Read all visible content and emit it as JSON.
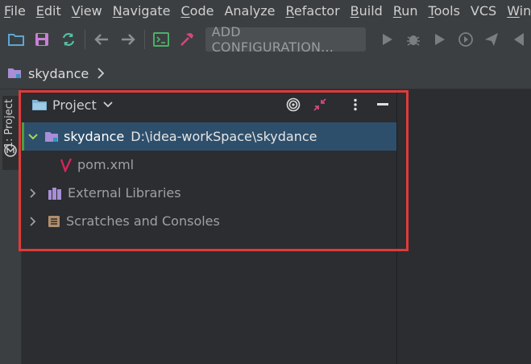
{
  "menu": {
    "items": [
      {
        "underline": "F",
        "rest": "ile"
      },
      {
        "underline": "E",
        "rest": "dit"
      },
      {
        "underline": "V",
        "rest": "iew"
      },
      {
        "underline": "N",
        "rest": "avigate"
      },
      {
        "underline": "C",
        "rest": "ode"
      },
      {
        "underline": "",
        "rest": "Analyze"
      },
      {
        "underline": "R",
        "rest": "efactor"
      },
      {
        "underline": "B",
        "rest": "uild"
      },
      {
        "underline": "R",
        "rest": "un",
        "prefix": ""
      },
      {
        "underline": "T",
        "rest": "ools"
      },
      {
        "underline": "",
        "rest": "VCS"
      },
      {
        "underline": "W",
        "rest": "indo"
      }
    ]
  },
  "toolbar": {
    "config_label": "ADD CONFIGURATION...",
    "icons": [
      "folder-open-icon",
      "save-icon",
      "sync-icon",
      "back-icon",
      "forward-icon",
      "terminal-icon",
      "build-hammer-icon",
      "run-icon",
      "debug-icon",
      "run-coverage-icon",
      "profile-icon",
      "deploy-icon"
    ]
  },
  "breadcrumb": {
    "project": "skydance"
  },
  "side_strip": {
    "tab_label": "1: Project"
  },
  "project_panel": {
    "title": "Project",
    "tree": [
      {
        "name": "skydance",
        "path": "D:\\idea-workSpace\\skydance",
        "expanded": true,
        "selected": true
      },
      {
        "name": "pom.xml"
      },
      {
        "name": "External Libraries",
        "expanded": false
      },
      {
        "name": "Scratches and Consoles",
        "expanded": false
      }
    ]
  },
  "colors": {
    "accent_selected": "#2e4f6b",
    "highlight_border": "#e03a3a",
    "folder": "#a78ed6",
    "maven": "#d6245a"
  }
}
